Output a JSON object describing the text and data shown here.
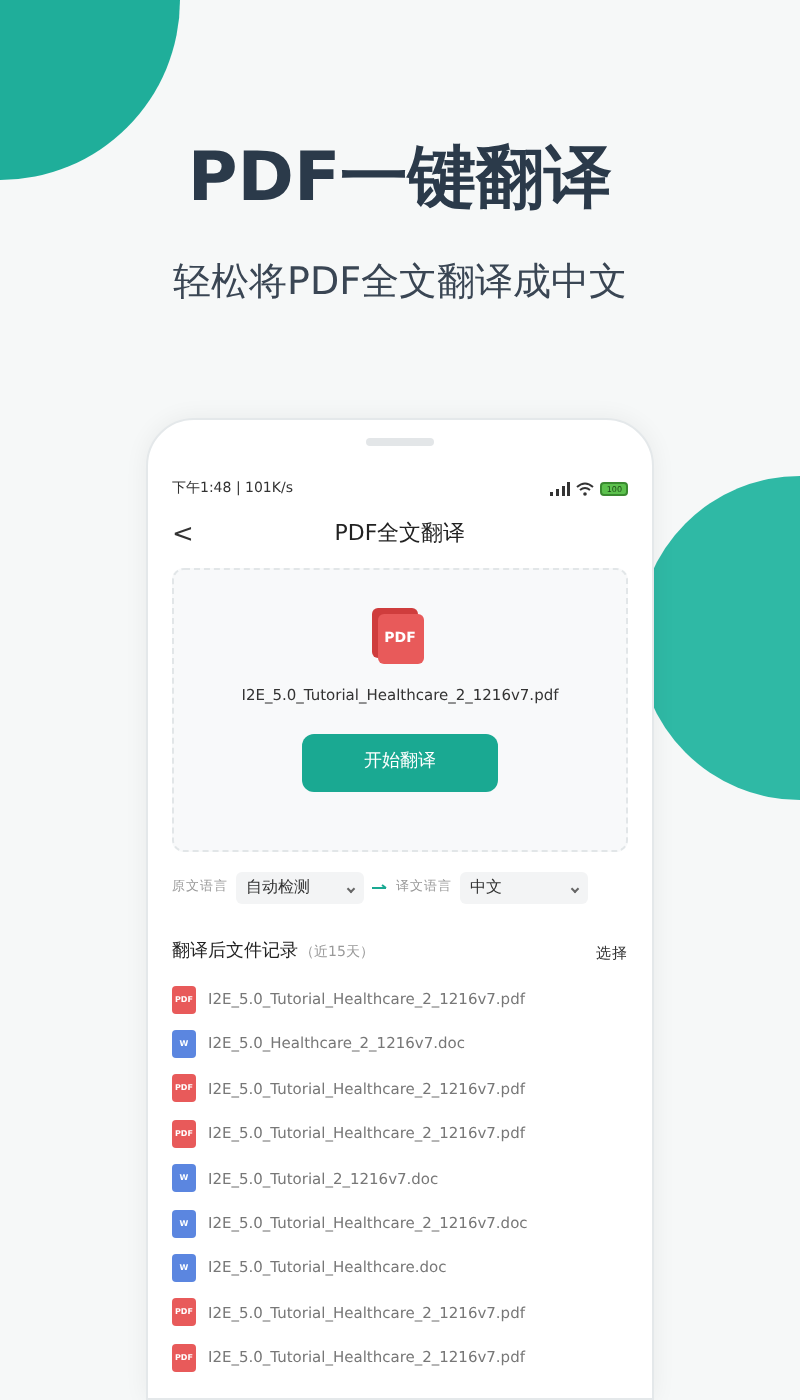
{
  "headline": "PDF一键翻译",
  "subtitle": "轻松将PDF全文翻译成中文",
  "status_bar": {
    "time": "下午1:48 | 101K/s",
    "battery": "100"
  },
  "nav": {
    "back": "<",
    "title": "PDF全文翻译"
  },
  "upload": {
    "icon_label": "PDF",
    "file_name": "I2E_5.0_Tutorial_Healthcare_2_1216v7.pdf",
    "button": "开始翻译"
  },
  "languages": {
    "source_label": "原文语言",
    "source_value": "自动检测",
    "target_label": "译文语言",
    "target_value": "中文"
  },
  "history": {
    "title": "翻译后文件记录",
    "note": "（近15天）",
    "action": "选择",
    "files": [
      {
        "kind": "pdf",
        "icon_label": "PDF",
        "name": "I2E_5.0_Tutorial_Healthcare_2_1216v7.pdf"
      },
      {
        "kind": "doc",
        "icon_label": "W",
        "name": "I2E_5.0_Healthcare_2_1216v7.doc"
      },
      {
        "kind": "pdf",
        "icon_label": "PDF",
        "name": "I2E_5.0_Tutorial_Healthcare_2_1216v7.pdf"
      },
      {
        "kind": "pdf",
        "icon_label": "PDF",
        "name": "I2E_5.0_Tutorial_Healthcare_2_1216v7.pdf"
      },
      {
        "kind": "doc",
        "icon_label": "W",
        "name": "I2E_5.0_Tutorial_2_1216v7.doc"
      },
      {
        "kind": "doc",
        "icon_label": "W",
        "name": "I2E_5.0_Tutorial_Healthcare_2_1216v7.doc"
      },
      {
        "kind": "doc",
        "icon_label": "W",
        "name": "I2E_5.0_Tutorial_Healthcare.doc"
      },
      {
        "kind": "pdf",
        "icon_label": "PDF",
        "name": "I2E_5.0_Tutorial_Healthcare_2_1216v7.pdf"
      },
      {
        "kind": "pdf",
        "icon_label": "PDF",
        "name": "I2E_5.0_Tutorial_Healthcare_2_1216v7.pdf"
      }
    ]
  }
}
